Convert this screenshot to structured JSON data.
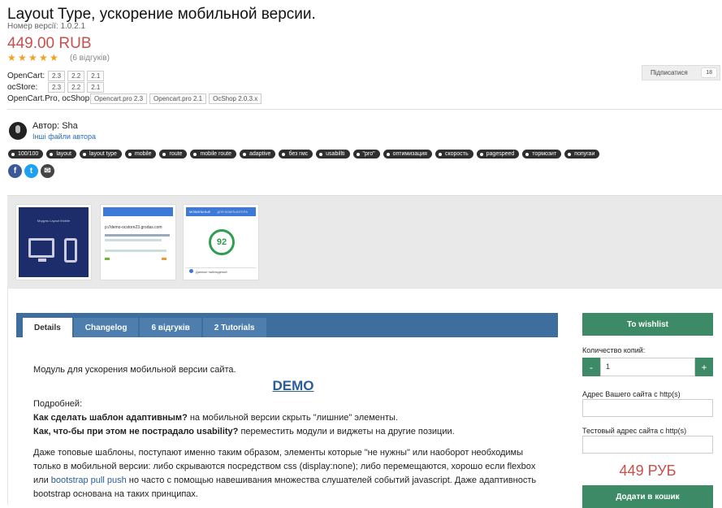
{
  "product": {
    "title": "Layout Type, ускорение мобильной версии.",
    "version": "Номер версії: 1.0.2.1",
    "price": "449.00 RUB",
    "stars": 5,
    "reviews": "(6 відгуків)"
  },
  "compat": [
    {
      "label": "OpenCart:",
      "versions": [
        "2.3",
        "2.2",
        "2.1"
      ]
    },
    {
      "label": "ocStore:",
      "versions": [
        "2.3",
        "2.2",
        "2.1"
      ]
    },
    {
      "label": "OpenCart.Pro, ocShop:",
      "versions": [
        "Opencart.pro 2.3",
        "Opencart.pro 2.1",
        "OcShop 2.0.3.x"
      ]
    }
  ],
  "subscribe": {
    "label": "Підписатися",
    "count": "18"
  },
  "author": {
    "name": "Автор: Sha",
    "files_link": "Інші файли автора"
  },
  "tags": [
    "100/100",
    "layout",
    "layout type",
    "mobile",
    "route",
    "mobile route",
    "adaptive",
    "без гмс",
    "usabillti",
    "\"pro\"",
    "оптимизация",
    "скорость",
    "pagespeed",
    "тормозит",
    "попугаи"
  ],
  "share": [
    {
      "name": "facebook-icon",
      "glyph": "f",
      "color": "#3b5998"
    },
    {
      "name": "twitter-icon",
      "glyph": "t",
      "color": "#1da1f2"
    },
    {
      "name": "email-icon",
      "glyph": "✉",
      "color": "#444444"
    }
  ],
  "gallery": {
    "thumb1_caption": "Модуль Layout Mobile",
    "thumb2_url": "p://demo-ocstore23.grodas.com",
    "thumb3_tab_a": "МОБИЛЬНЫЕ",
    "thumb3_tab_b": "ДЛЯ КОМПЬЮТЕРА",
    "thumb3_score": "92",
    "thumb3_footer": "Данные наблюдений"
  },
  "tabs": [
    "Details",
    "Changelog",
    "6 відгуків",
    "2 Tutorials"
  ],
  "description": {
    "intro": "Модуль для ускорения мобильной версии сайта.",
    "demo": "DEMO",
    "more": "Подробней:",
    "q1_bold": "Как сделать шаблон адаптивным?",
    "q1_rest": " на мобильной версии скрыть \"лишние\" элементы.",
    "q2_bold": "Как, что-бы при этом не пострадало usability?",
    "q2_rest": " переместить модули и виджеты на другие позиции.",
    "para_start": "Даже топовые шаблоны, поступают именно таким образом, элементы которые \"не нужны\" или наоборот необходимы только в мобильной версии: либо скрываются посредством css (display:none); либо перемещаются, хорошо если flexbox или ",
    "para_link": "bootstrap pull push",
    "para_end": " но часто с помощью навешивания множества слушателей событий javascript. Даже адаптивность bootstrap основана на таких принципах."
  },
  "purchase": {
    "wishlist": "To wishlist",
    "qty_label": "Количество копий:",
    "qty_minus": "-",
    "qty_value": "1",
    "qty_plus": "+",
    "site_label": "Адрес Вашего сайта с http(s)",
    "test_label": "Тестовый адрес сайта с http(s)",
    "price": "449 РУБ",
    "add_to_cart": "Додати в кошик"
  },
  "colors": {
    "accent_green": "#3d8b66",
    "tab_bar": "#3e6e9e",
    "price_red": "#c9504a"
  }
}
